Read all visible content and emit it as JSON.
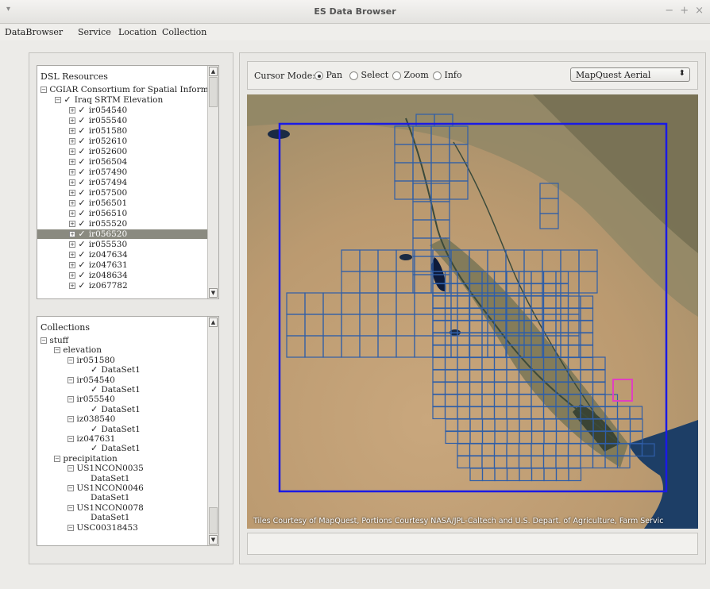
{
  "window": {
    "title": "ES Data Browser",
    "menu_glyph": "▾",
    "ctrl_min": "−",
    "ctrl_max": "+",
    "ctrl_close": "×"
  },
  "menubar": {
    "items": [
      "DataBrowser",
      "Service",
      "Location",
      "Collection"
    ]
  },
  "dsl": {
    "header": "DSL Resources",
    "root": "CGIAR Consortium for Spatial Inform...",
    "group": "Iraq SRTM Elevation",
    "items": [
      "ir054540",
      "ir055540",
      "ir051580",
      "ir052610",
      "ir052600",
      "ir056504",
      "ir057490",
      "ir057494",
      "ir057500",
      "ir056501",
      "ir056510",
      "ir055520",
      "ir056520",
      "ir055530",
      "iz047634",
      "iz047631",
      "iz048634",
      "iz067782"
    ],
    "selected_index": 12
  },
  "collections": {
    "header": "Collections",
    "rows": [
      {
        "text": "stuff",
        "indent": 0,
        "exp": "−"
      },
      {
        "text": "elevation",
        "indent": 1,
        "exp": "−"
      },
      {
        "text": "ir051580",
        "indent": 2,
        "exp": "−"
      },
      {
        "text": "DataSet1",
        "indent": 3,
        "check": true
      },
      {
        "text": "ir054540",
        "indent": 2,
        "exp": "−"
      },
      {
        "text": "DataSet1",
        "indent": 3,
        "check": true
      },
      {
        "text": "ir055540",
        "indent": 2,
        "exp": "−"
      },
      {
        "text": "DataSet1",
        "indent": 3,
        "check": true
      },
      {
        "text": "iz038540",
        "indent": 2,
        "exp": "−"
      },
      {
        "text": "DataSet1",
        "indent": 3,
        "check": true
      },
      {
        "text": "iz047631",
        "indent": 2,
        "exp": "−"
      },
      {
        "text": "DataSet1",
        "indent": 3,
        "check": true
      },
      {
        "text": "precipitation",
        "indent": 1,
        "exp": "−"
      },
      {
        "text": "US1NCON0035",
        "indent": 2,
        "exp": "−"
      },
      {
        "text": "DataSet1",
        "indent": 3
      },
      {
        "text": "US1NCON0046",
        "indent": 2,
        "exp": "−"
      },
      {
        "text": "DataSet1",
        "indent": 3
      },
      {
        "text": "US1NCON0078",
        "indent": 2,
        "exp": "−"
      },
      {
        "text": "DataSet1",
        "indent": 3
      },
      {
        "text": "USC00318453",
        "indent": 2,
        "exp": "−"
      }
    ]
  },
  "toolbar": {
    "cursor_label": "Cursor Mode:",
    "modes": [
      "Pan",
      "Select",
      "Zoom",
      "Info"
    ],
    "selected_mode": "Pan",
    "basemap": "MapQuest Aerial",
    "basemap_arrow": "⬍"
  },
  "map": {
    "attribution": "Tiles Courtesy of MapQuest, Portions Courtesy NASA/JPL-Caltech and U.S. Depart. of Agriculture, Farm Servic",
    "colors": {
      "grid": "#2f5ea8",
      "bounds": "#1a1ae6",
      "highlight": "#e040c0"
    }
  }
}
